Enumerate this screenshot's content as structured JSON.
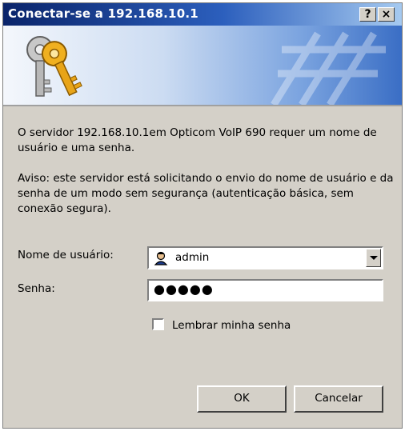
{
  "dialog": {
    "title": "Conectar-se a 192.168.10.1",
    "help_label": "?",
    "close_label": "×"
  },
  "message": {
    "server_info": "O servidor 192.168.10.1em Opticom VoIP 690 requer um nome de usuário e uma senha.",
    "warning": "Aviso: este servidor está solicitando o envio do nome de usuário e da senha de um modo sem segurança (autenticação básica, sem conexão segura)."
  },
  "form": {
    "username_label": "Nome de usuário:",
    "username_value": "admin",
    "password_label": "Senha:",
    "password_value": "●●●●●",
    "remember_label": "Lembrar minha senha",
    "remember_checked": false
  },
  "buttons": {
    "ok": "OK",
    "cancel": "Cancelar"
  }
}
